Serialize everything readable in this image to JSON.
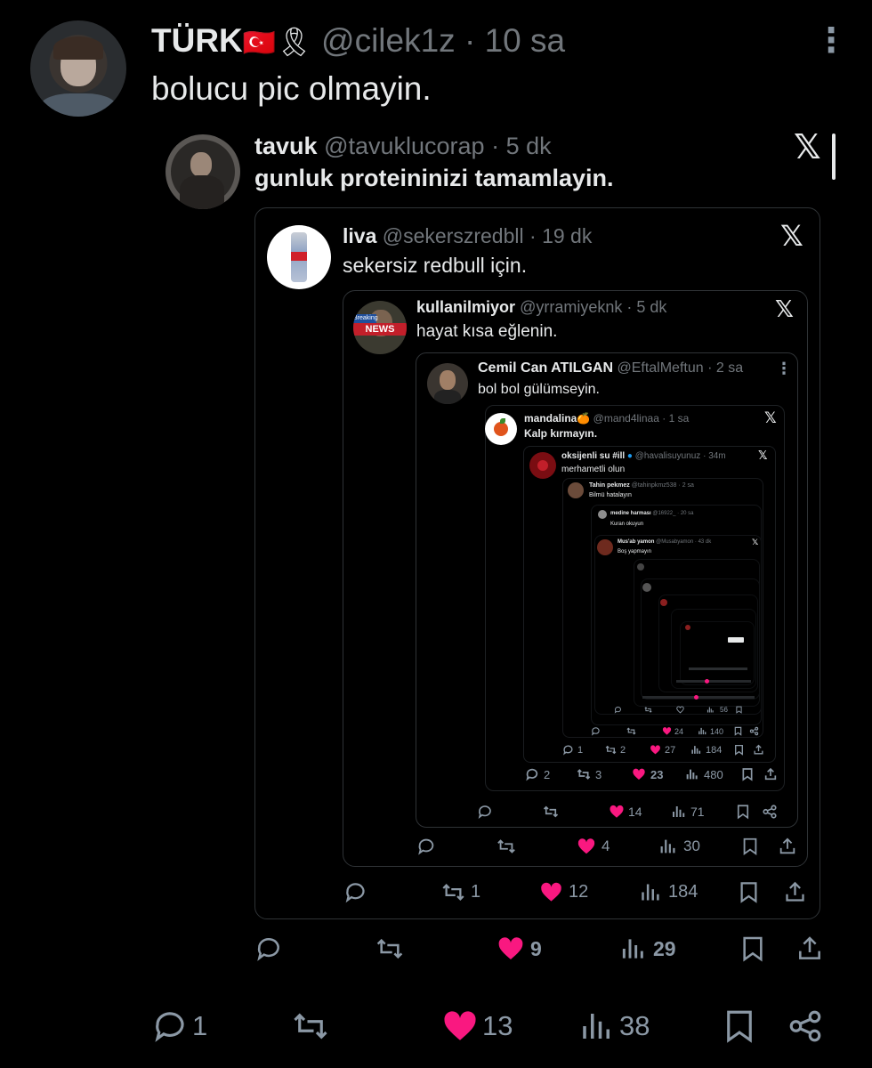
{
  "post": {
    "name": "TÜRK",
    "flag_emoji": "🇹🇷",
    "ribbon_emoji": "🎗",
    "handle": "@cilek1z",
    "separator": "·",
    "time": "10 sa",
    "text": "bolucu pic olmayin.",
    "reply_count": "1",
    "like_count": "13",
    "view_count": "38"
  },
  "quotes": [
    {
      "name": "tavuk",
      "handle": "@tavuklucorap",
      "time": "5 dk",
      "text": "gunluk proteininizi tamamlayin.",
      "like_count": "9",
      "view_count": "29"
    },
    {
      "name": "liva",
      "handle": "@sekerszredbll",
      "time": "19 dk",
      "text": "sekersiz redbull için.",
      "repost_count": "1",
      "like_count": "12",
      "view_count": "184"
    },
    {
      "name": "kullanilmiyor",
      "handle": "@yrramiyeknk",
      "time": "5 dk",
      "text": "hayat kısa eğlenin.",
      "like_count": "4",
      "view_count": "30",
      "avatar_badge_top": "Breaking",
      "avatar_badge": "NEWS"
    },
    {
      "name": "Cemil Can ATILGAN",
      "handle": "@EftalMeftun",
      "time": "2 sa",
      "text": "bol bol gülümseyin.",
      "like_count": "14",
      "view_count": "71"
    },
    {
      "name": "mandalina🍊",
      "handle": "@mand4linaa",
      "time": "1 sa",
      "text": "Kalp kırmayın.",
      "reply_count": "2",
      "repost_count": "3",
      "like_count": "23",
      "view_count": "480"
    },
    {
      "name": "oksijenli su #ill",
      "handle": "@havalisuyunuz",
      "time": "34m",
      "text": "merhametli olun",
      "reply_count": "1",
      "repost_count": "2",
      "like_count": "27",
      "view_count": "184"
    },
    {
      "name": "Tahin pekmez",
      "handle": "@tahinpkmz538",
      "time": "2 sa",
      "text": "Bilmü hatalayın",
      "like_count": "24",
      "view_count": "140"
    },
    {
      "name": "medine harması",
      "handle": "@16922_",
      "time": "20 sa",
      "text": "Kuran okuyun",
      "view_count": "56"
    },
    {
      "name": "Mus'ab yamon",
      "handle": "@Musabyamon",
      "time": "43 dk",
      "text": "Boş yapmayın"
    }
  ],
  "icons": {
    "x_logo": "𝕏",
    "more": "⋮"
  },
  "colors": {
    "background": "#000000",
    "text": "#e7e9ea",
    "secondary": "#71767b",
    "like": "#f91880",
    "border": "#2f3336"
  }
}
